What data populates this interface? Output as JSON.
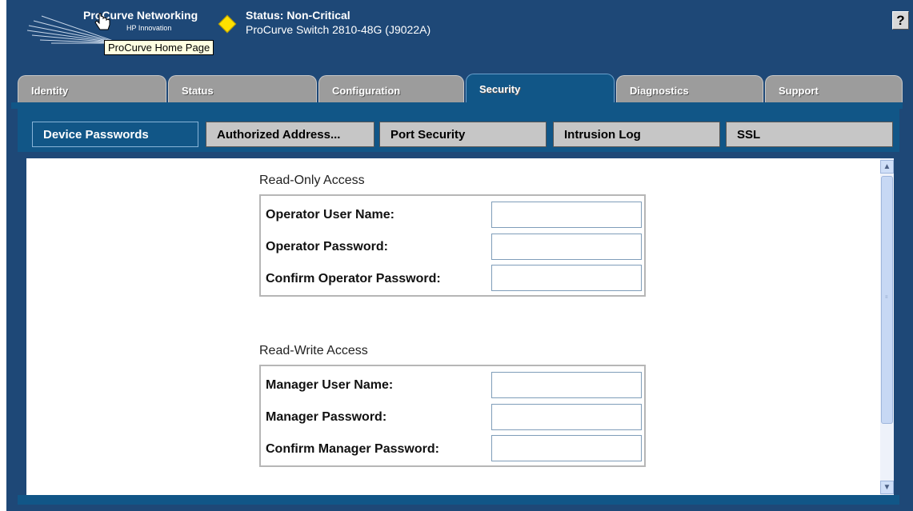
{
  "header": {
    "logo_title": "ProCurve Networking",
    "logo_subtitle": "HP Innovation",
    "tooltip": "ProCurve Home Page",
    "status_title": "Status: Non-Critical",
    "device": "ProCurve Switch 2810-48G (J9022A)",
    "status_color": "#ffe000",
    "help_label": "?"
  },
  "tabs": [
    {
      "label": "Identity",
      "active": false
    },
    {
      "label": "Status",
      "active": false
    },
    {
      "label": "Configuration",
      "active": false
    },
    {
      "label": "Security",
      "active": true
    },
    {
      "label": "Diagnostics",
      "active": false
    },
    {
      "label": "Support",
      "active": false
    }
  ],
  "subtabs": [
    {
      "label": "Device Passwords",
      "active": true
    },
    {
      "label": "Authorized Address...",
      "active": false
    },
    {
      "label": "Port Security",
      "active": false
    },
    {
      "label": "Intrusion Log",
      "active": false
    },
    {
      "label": "SSL",
      "active": false
    }
  ],
  "read_only": {
    "title": "Read-Only Access",
    "fields": [
      {
        "label": "Operator User Name:",
        "value": ""
      },
      {
        "label": "Operator Password:",
        "value": ""
      },
      {
        "label": "Confirm Operator Password:",
        "value": ""
      }
    ]
  },
  "read_write": {
    "title": "Read-Write Access",
    "fields": [
      {
        "label": "Manager User Name:",
        "value": ""
      },
      {
        "label": "Manager Password:",
        "value": ""
      },
      {
        "label": "Confirm Manager Password:",
        "value": ""
      }
    ]
  },
  "colors": {
    "frame": "#1e4877",
    "active_tab": "#115687",
    "inactive_tab": "#9c9c9c"
  },
  "icons": {
    "logo": "procurve-logo-rays",
    "status": "diamond-warning-icon",
    "cursor": "hand-pointer-icon",
    "scroll_up": "scroll-up-arrow-icon",
    "scroll_down": "scroll-down-arrow-icon"
  }
}
